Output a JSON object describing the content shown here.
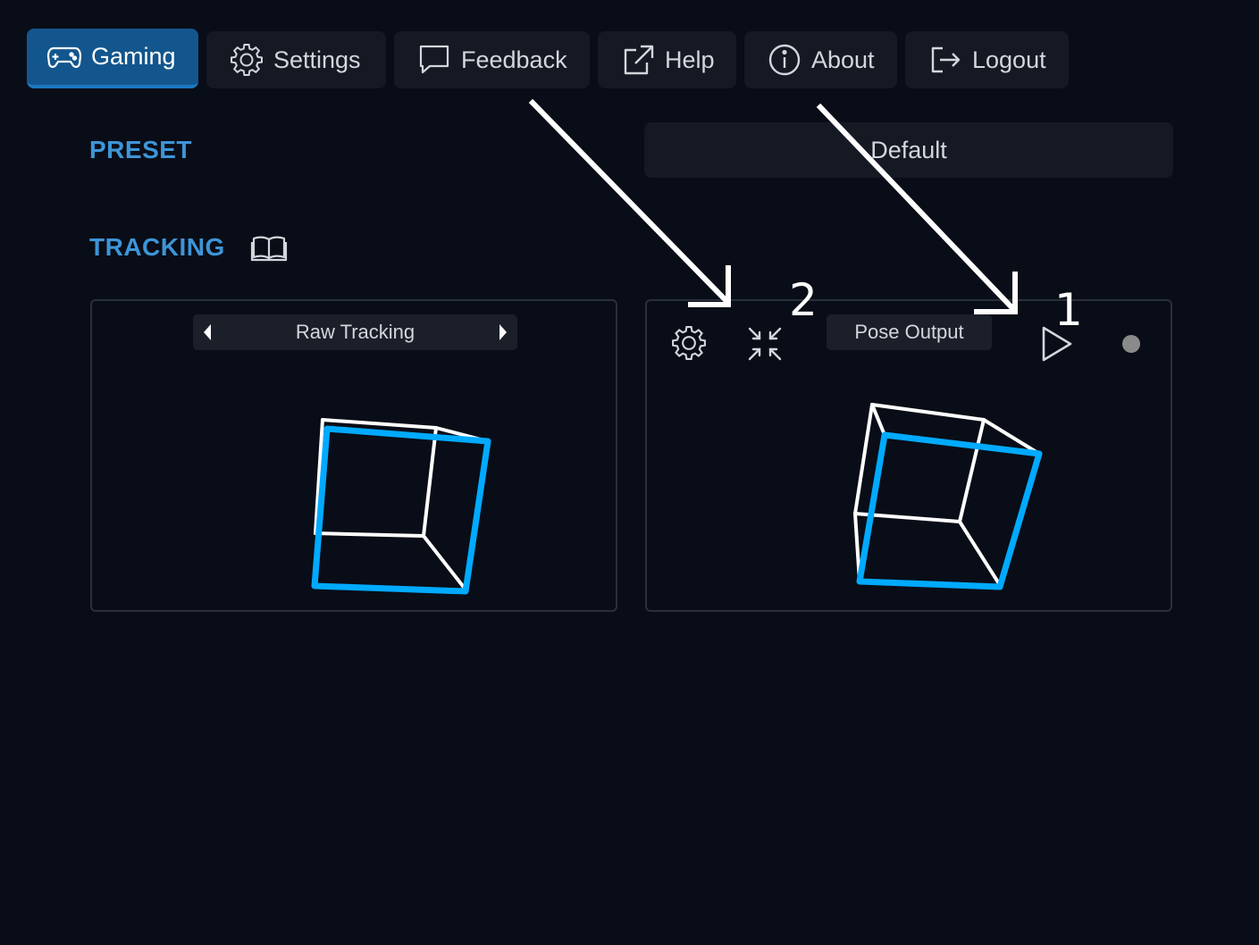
{
  "nav": {
    "tabs": [
      {
        "label": "Gaming",
        "icon": "gamepad-icon",
        "active": true
      },
      {
        "label": "Settings",
        "icon": "gear-icon",
        "active": false
      },
      {
        "label": "Feedback",
        "icon": "speech-bubble-icon",
        "active": false
      },
      {
        "label": "Help",
        "icon": "external-link-icon",
        "active": false
      },
      {
        "label": "About",
        "icon": "info-icon",
        "active": false
      },
      {
        "label": "Logout",
        "icon": "logout-icon",
        "active": false
      }
    ]
  },
  "preset": {
    "label": "PRESET",
    "value": "Default"
  },
  "tracking": {
    "label": "TRACKING",
    "icon": "book-icon"
  },
  "raw_panel": {
    "view_label": "Raw Tracking"
  },
  "pose_panel": {
    "label": "Pose Output",
    "icons": [
      "gear-icon",
      "recenter-icon",
      "play-icon",
      "status-dot-icon"
    ]
  },
  "annotations": {
    "num1": "1",
    "num2": "2"
  },
  "colors": {
    "background": "#090d17",
    "accent": "#3e95d7",
    "active_tab": "#13568d",
    "cube_front": "#00aaff",
    "cube_back": "#ffffff"
  }
}
